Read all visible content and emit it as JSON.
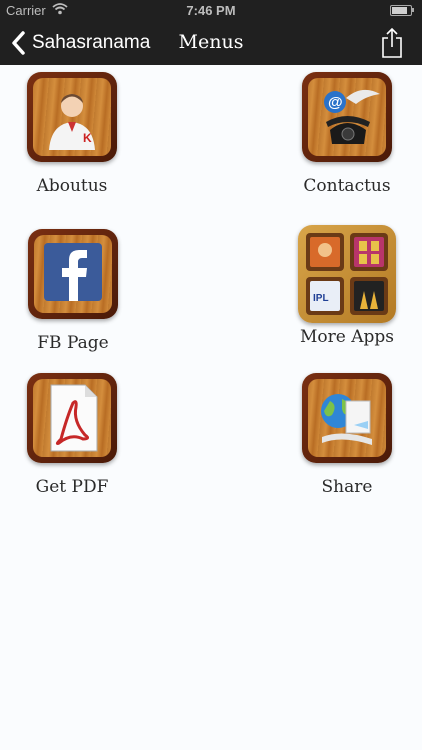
{
  "status_bar": {
    "carrier": "Carrier",
    "time": "7:46 PM"
  },
  "nav": {
    "back_label": "Sahasranama",
    "title": "Menus"
  },
  "menu": {
    "aboutus": "Aboutus",
    "contactus": "Contactus",
    "fbpage": "FB Page",
    "moreapps": "More Apps",
    "getpdf": "Get PDF",
    "share": "Share"
  },
  "icons": {
    "back": "chevron-left-icon",
    "share": "share-icon",
    "aboutus": "person-icon",
    "contactus": "telephone-icon",
    "fbpage": "facebook-icon",
    "moreapps": "apps-grid-icon",
    "getpdf": "pdf-icon",
    "share_tile": "globe-share-icon"
  },
  "colors": {
    "nav_bg": "#202020",
    "page_bg": "#fafcfe",
    "wood": "#c07a2f",
    "frame": "#5a200b"
  }
}
